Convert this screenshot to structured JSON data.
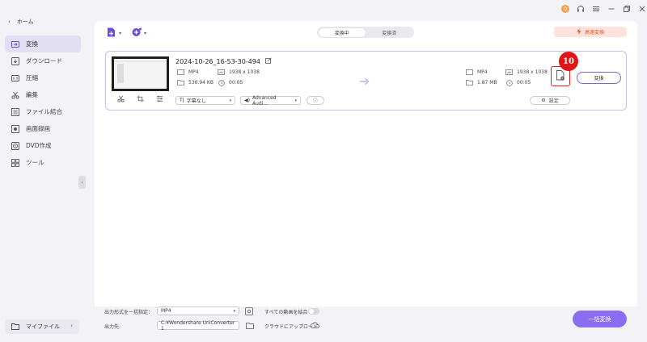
{
  "sidebar": {
    "home_label": "ホーム",
    "items": [
      {
        "label": "変換",
        "icon": "convert-icon",
        "active": true
      },
      {
        "label": "ダウンロード",
        "icon": "download-icon"
      },
      {
        "label": "圧縮",
        "icon": "compress-icon"
      },
      {
        "label": "編集",
        "icon": "edit-icon"
      },
      {
        "label": "ファイル結合",
        "icon": "merge-icon"
      },
      {
        "label": "画面録画",
        "icon": "screen-record-icon"
      },
      {
        "label": "DVD作成",
        "icon": "dvd-icon"
      },
      {
        "label": "ツール",
        "icon": "toolbox-icon"
      }
    ],
    "my_files_label": "マイファイル"
  },
  "titlebar": {
    "avatar_letter": "Q"
  },
  "header": {
    "tabs": [
      {
        "label": "変換中",
        "active": true
      },
      {
        "label": "変換済"
      }
    ],
    "high_speed_label": "高速変換"
  },
  "file": {
    "name": "2024-10-26_16-53-30-494",
    "source": {
      "format": "MP4",
      "resolution": "1938 x 1038",
      "size": "536.94 KB",
      "duration": "00:05"
    },
    "output": {
      "format": "MP4",
      "resolution": "1938 x 1038",
      "size": "1.87 MB",
      "duration": "00:05"
    },
    "subtitle_label": "字幕なし",
    "audio_label": "Advanced Audi...",
    "settings_label": "設定",
    "convert_label": "変換",
    "badge_number": "10"
  },
  "bottom": {
    "output_format_label": "出力形式を一括指定：",
    "output_format_value": "MP4",
    "merge_label": "すべての動画を結合",
    "output_path_label": "出力先:",
    "output_path_value": "C:¥Wondershare UniConverter 1",
    "cloud_upload_label": "クラウドにアップロード",
    "batch_convert_label": "一括変換"
  },
  "colors": {
    "accent": "#8a6ef0",
    "highlight_red": "#e01515",
    "high_speed_text": "#e2561f"
  }
}
